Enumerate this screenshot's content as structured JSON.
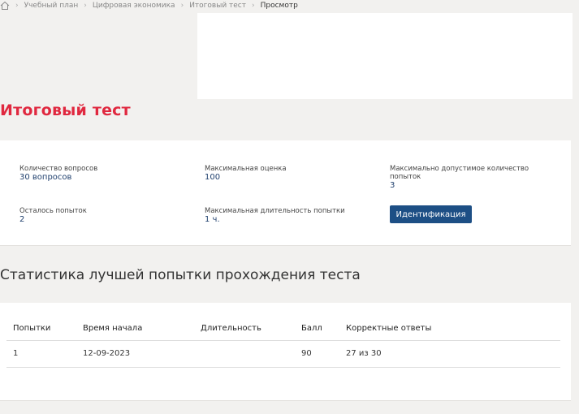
{
  "breadcrumb": {
    "items": [
      "Учебный план",
      "Цифровая экономика",
      "Итоговый тест",
      "Просмотр"
    ]
  },
  "page": {
    "title": "Итоговый тест"
  },
  "info": {
    "questions_label": "Количество вопросов",
    "questions_value": "30 вопросов",
    "max_score_label": "Максимальная оценка",
    "max_score_value": "100",
    "max_attempts_label": "Максимально допустимое количество попыток",
    "max_attempts_value": "3",
    "attempts_left_label": "Осталось попыток",
    "attempts_left_value": "2",
    "max_duration_label": "Максимальная длительность попытки",
    "max_duration_value": "1 ч.",
    "ident_button": "Идентификация"
  },
  "stats": {
    "title": "Статистика лучшей попытки прохождения теста",
    "columns": [
      "Попытки",
      "Время начала",
      "Длительность",
      "Балл",
      "Корректные ответы"
    ],
    "rows": [
      [
        "1",
        "12-09-2023",
        "",
        "90",
        "27 из 30"
      ]
    ]
  },
  "colors": {
    "title_red": "#e0283f",
    "value_blue": "#1f3f6d",
    "button_blue": "#1d4f85"
  }
}
